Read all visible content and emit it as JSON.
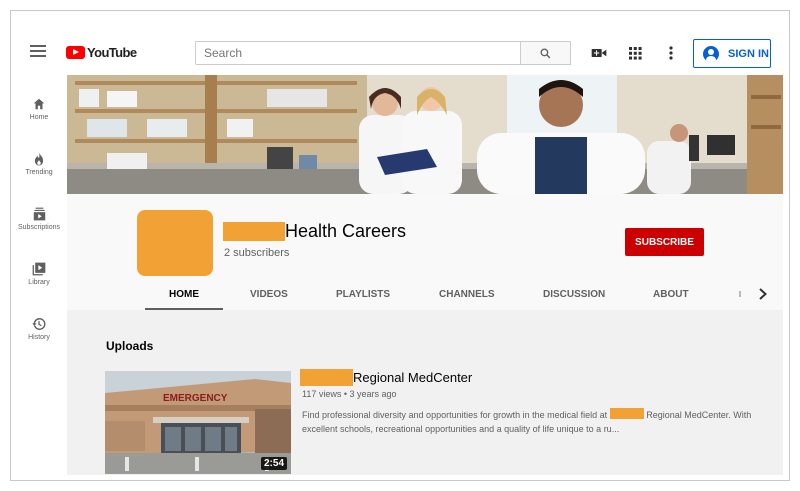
{
  "app": {
    "brand": "YouTube"
  },
  "header": {
    "search_placeholder": "Search",
    "signin_label": "SIGN IN",
    "icons": [
      "menu-icon",
      "search-icon",
      "video-camera-icon",
      "apps-grid-icon",
      "more-vert-icon",
      "account-circle-icon"
    ]
  },
  "sidebar": {
    "items": [
      {
        "label": "Home",
        "icon": "home-icon"
      },
      {
        "label": "Trending",
        "icon": "flame-icon"
      },
      {
        "label": "Subscriptions",
        "icon": "subscriptions-icon"
      },
      {
        "label": "Library",
        "icon": "library-icon"
      },
      {
        "label": "History",
        "icon": "history-icon"
      }
    ]
  },
  "channel": {
    "name": "Health Careers",
    "subscribers": "2 subscribers",
    "subscribe_label": "SUBSCRIBE",
    "tabs": [
      {
        "label": "HOME",
        "active": true
      },
      {
        "label": "VIDEOS",
        "active": false
      },
      {
        "label": "PLAYLISTS",
        "active": false
      },
      {
        "label": "CHANNELS",
        "active": false
      },
      {
        "label": "DISCUSSION",
        "active": false
      },
      {
        "label": "ABOUT",
        "active": false
      }
    ]
  },
  "uploads": {
    "section_title": "Uploads",
    "video": {
      "title": "Regional MedCenter",
      "meta": "117 views • 3 years ago",
      "description_before": "Find professional diversity and opportunities for growth in the medical field at",
      "description_after": "Regional MedCenter. With excellent schools, recreational opportunities and a quality of life unique to a ru...",
      "duration": "2:54",
      "thumbnail_sign": "EMERGENCY"
    }
  },
  "colors": {
    "brand_red": "#ff0000",
    "subscribe_red": "#cc0000",
    "link_blue": "#065fd4",
    "redaction_orange": "#f2a234"
  }
}
